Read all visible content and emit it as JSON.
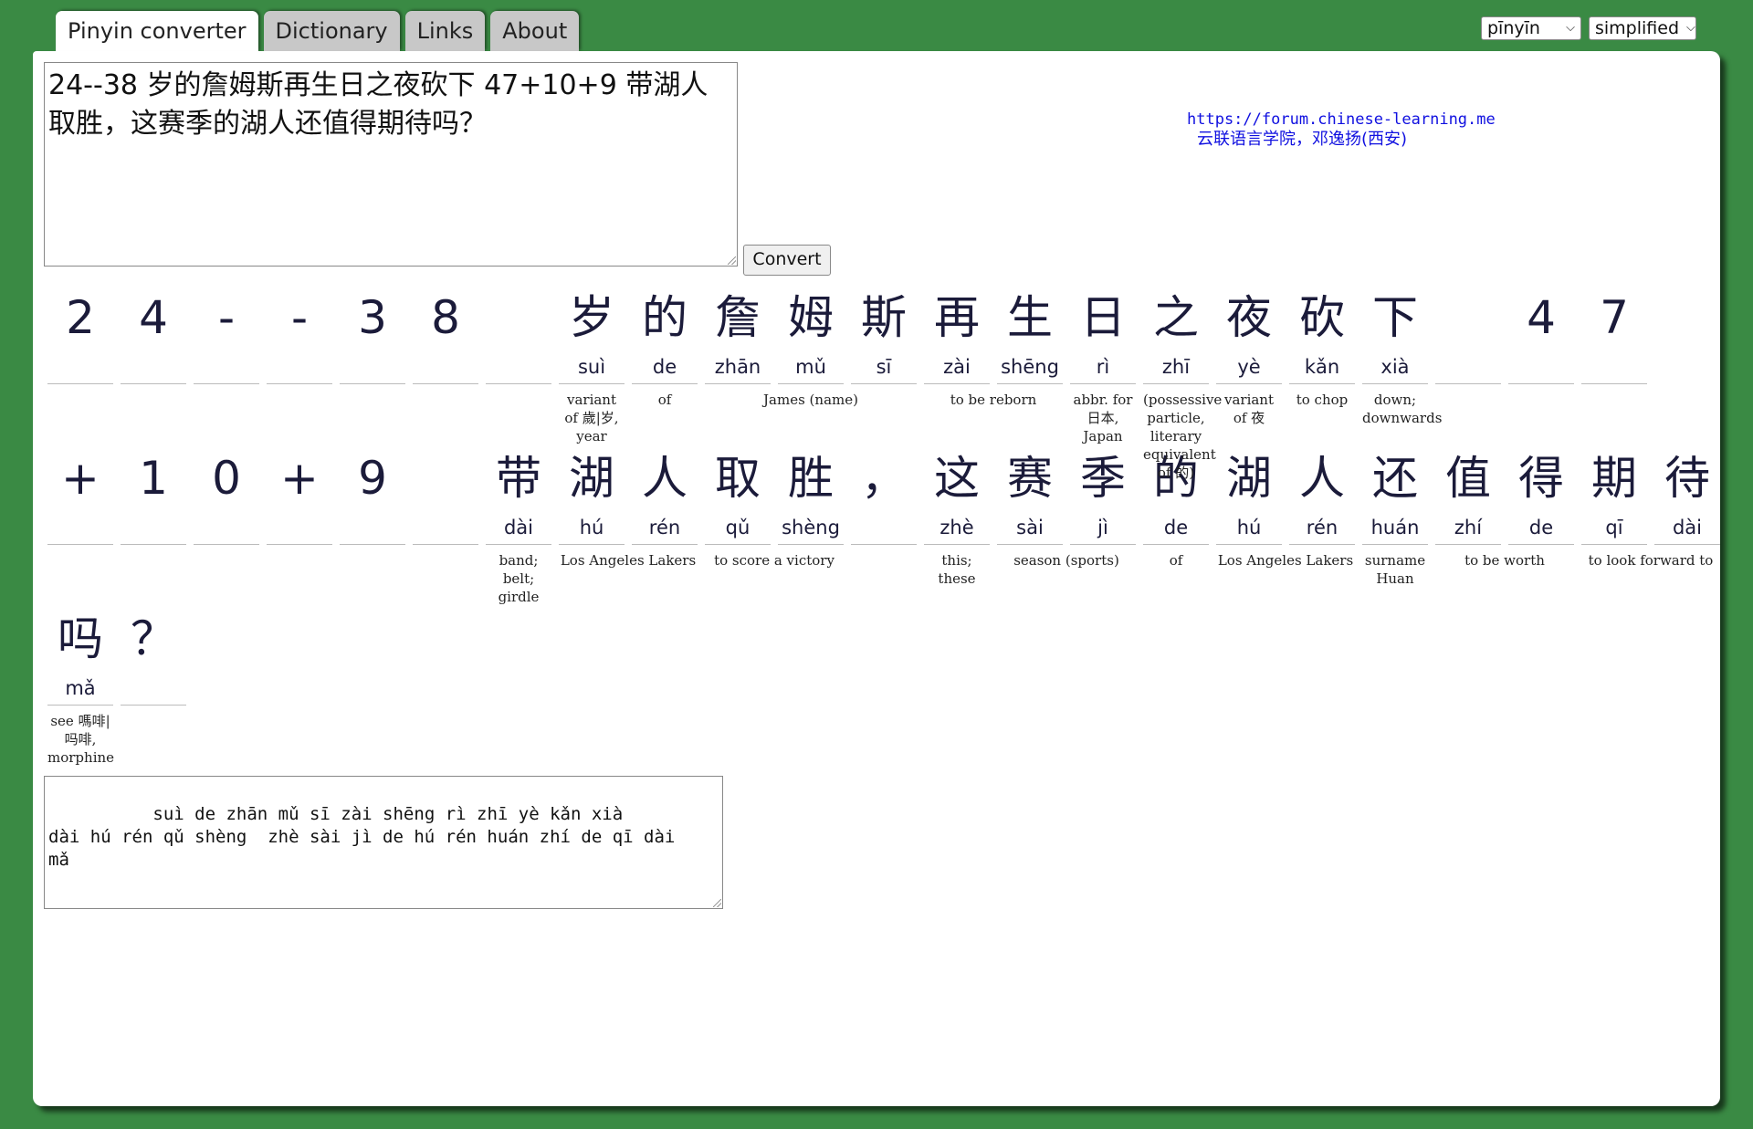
{
  "tabs": [
    {
      "label": "Pinyin converter",
      "active": true
    },
    {
      "label": "Dictionary",
      "active": false
    },
    {
      "label": "Links",
      "active": false
    },
    {
      "label": "About",
      "active": false
    }
  ],
  "selects": {
    "pinyin_mode": "pīnyīn",
    "script": "simplified"
  },
  "input_text": "24--38 岁的詹姆斯再生日之夜砍下 47+10+9 带湖人取胜，这赛季的湖人还值得期待吗？",
  "convert_label": "Convert",
  "credits": {
    "url": "https://forum.chinese-learning.me",
    "org": "云联语言学院，邓逸扬(西安)"
  },
  "rows": [
    [
      {
        "c": "2",
        "p": ""
      },
      {
        "c": "4",
        "p": ""
      },
      {
        "c": "-",
        "p": ""
      },
      {
        "c": "-",
        "p": ""
      },
      {
        "c": "3",
        "p": ""
      },
      {
        "c": "8",
        "p": ""
      },
      {
        "c": "",
        "p": ""
      },
      {
        "c": "岁",
        "p": "suì"
      },
      {
        "c": "的",
        "p": "de"
      },
      {
        "c": "詹",
        "p": "zhān"
      },
      {
        "c": "姆",
        "p": "mǔ"
      },
      {
        "c": "斯",
        "p": "sī"
      },
      {
        "c": "再",
        "p": "zài"
      },
      {
        "c": "生",
        "p": "shēng"
      },
      {
        "c": "日",
        "p": "rì"
      },
      {
        "c": "之",
        "p": "zhī"
      },
      {
        "c": "夜",
        "p": "yè"
      },
      {
        "c": "砍",
        "p": "kǎn"
      },
      {
        "c": "下",
        "p": "xià"
      },
      {
        "c": "",
        "p": ""
      },
      {
        "c": "4",
        "p": ""
      },
      {
        "c": "7",
        "p": ""
      }
    ],
    [
      {
        "c": "+",
        "p": ""
      },
      {
        "c": "1",
        "p": ""
      },
      {
        "c": "0",
        "p": ""
      },
      {
        "c": "+",
        "p": ""
      },
      {
        "c": "9",
        "p": ""
      },
      {
        "c": "",
        "p": ""
      },
      {
        "c": "带",
        "p": "dài"
      },
      {
        "c": "湖",
        "p": "hú"
      },
      {
        "c": "人",
        "p": "rén"
      },
      {
        "c": "取",
        "p": "qǔ"
      },
      {
        "c": "胜",
        "p": "shèng"
      },
      {
        "c": "，",
        "p": ""
      },
      {
        "c": "这",
        "p": "zhè"
      },
      {
        "c": "赛",
        "p": "sài"
      },
      {
        "c": "季",
        "p": "jì"
      },
      {
        "c": "的",
        "p": "de"
      },
      {
        "c": "湖",
        "p": "hú"
      },
      {
        "c": "人",
        "p": "rén"
      },
      {
        "c": "还",
        "p": "huán"
      },
      {
        "c": "值",
        "p": "zhí"
      },
      {
        "c": "得",
        "p": "de"
      },
      {
        "c": "期",
        "p": "qī"
      },
      {
        "c": "待",
        "p": "dài"
      }
    ],
    [
      {
        "c": "吗",
        "p": "mǎ"
      },
      {
        "c": "？",
        "p": ""
      }
    ]
  ],
  "glosses": [
    [
      {
        "start": 7,
        "span": 1,
        "text": "variant of 歲|岁, year"
      },
      {
        "start": 8,
        "span": 1,
        "text": "of"
      },
      {
        "start": 9,
        "span": 3,
        "text": "James (name)"
      },
      {
        "start": 12,
        "span": 2,
        "text": "to be reborn"
      },
      {
        "start": 14,
        "span": 1,
        "text": "abbr. for 日本, Japan"
      },
      {
        "start": 15,
        "span": 1,
        "text": "(possessive particle, literary equivalent of 的)"
      },
      {
        "start": 16,
        "span": 1,
        "text": "variant of 夜"
      },
      {
        "start": 17,
        "span": 1,
        "text": "to chop"
      },
      {
        "start": 18,
        "span": 1,
        "text": "down; downwards"
      }
    ],
    [
      {
        "start": 6,
        "span": 1,
        "text": "band; belt; girdle"
      },
      {
        "start": 7,
        "span": 2,
        "text": "Los Angeles Lakers"
      },
      {
        "start": 9,
        "span": 2,
        "text": "to score a victory"
      },
      {
        "start": 12,
        "span": 1,
        "text": "this; these"
      },
      {
        "start": 13,
        "span": 2,
        "text": "season (sports)"
      },
      {
        "start": 15,
        "span": 1,
        "text": "of"
      },
      {
        "start": 16,
        "span": 2,
        "text": "Los Angeles Lakers"
      },
      {
        "start": 18,
        "span": 1,
        "text": "surname Huan"
      },
      {
        "start": 19,
        "span": 2,
        "text": "to be worth"
      },
      {
        "start": 21,
        "span": 2,
        "text": "to look forward to"
      }
    ],
    [
      {
        "start": 0,
        "span": 1,
        "text": "see 嗎啡|吗啡, morphine"
      }
    ]
  ],
  "output_text": "      suì de zhān mǔ sī zài shēng rì zhī yè kǎn xià\ndài hú rén qǔ shèng  zhè sài jì de hú rén huán zhí de qī dài\nmǎ"
}
